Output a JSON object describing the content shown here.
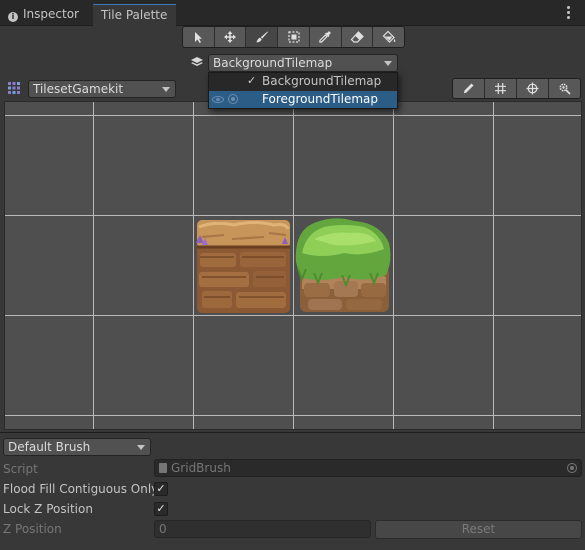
{
  "tabs": [
    {
      "label": "Inspector",
      "icon": "info-icon"
    },
    {
      "label": "Tile Palette"
    }
  ],
  "toolbar": {
    "tools": [
      "select-tool",
      "move-tool",
      "paint-brush-tool",
      "box-fill-tool",
      "pick-tool",
      "erase-tool",
      "flood-fill-tool"
    ],
    "active_tool": "paint-brush-tool"
  },
  "active_tilemap": {
    "selected": "BackgroundTilemap",
    "options": [
      {
        "label": "BackgroundTilemap",
        "checked": true
      },
      {
        "label": "ForegroundTilemap",
        "highlighted": true
      }
    ]
  },
  "palette": {
    "selected": "TilesetGamekit"
  },
  "grid_tools": [
    "edit-palette-icon",
    "grid-icon",
    "gizmo-icon",
    "settings-icon"
  ],
  "tiles": [
    {
      "name": "dirt-stone-tile"
    },
    {
      "name": "grass-stone-tile"
    }
  ],
  "brush": {
    "selected": "Default Brush",
    "script_label": "Script",
    "script_value": "GridBrush",
    "flood_fill_label": "Flood Fill Contiguous Only",
    "flood_fill_checked": "✓",
    "lock_z_label": "Lock Z Position",
    "lock_z_checked": "✓",
    "z_position_label": "Z Position",
    "z_position_value": "0",
    "reset_label": "Reset"
  },
  "colors": {
    "background": "#383838",
    "tab_bar": "#282828",
    "canvas": "#4f4f4f",
    "grid_line": "#b9b9b9",
    "selection": "#2c5d87"
  }
}
